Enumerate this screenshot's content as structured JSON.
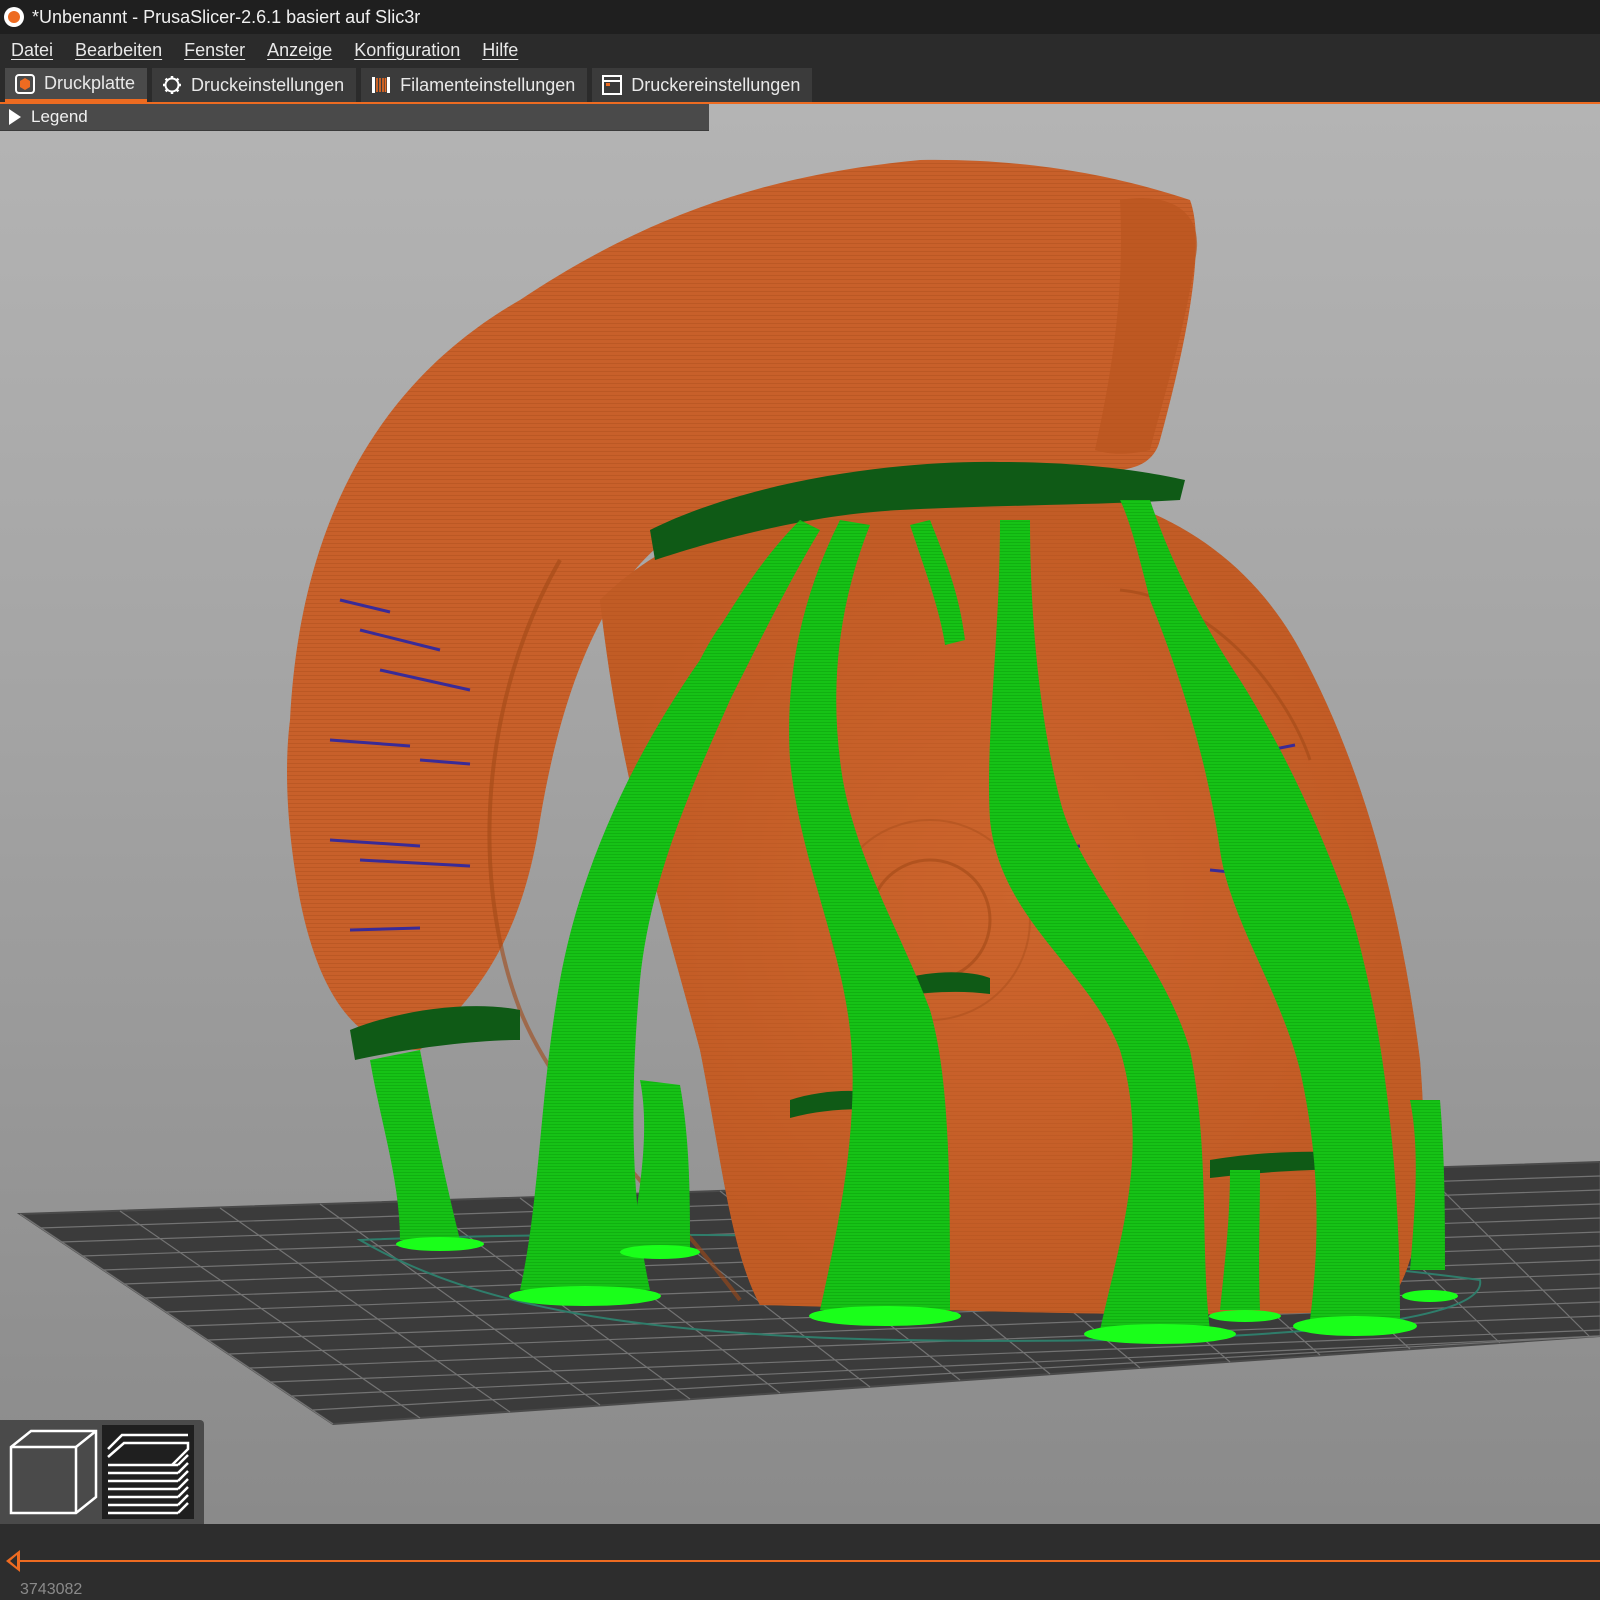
{
  "window": {
    "title": "*Unbenannt - PrusaSlicer-2.6.1 basiert auf Slic3r"
  },
  "menu": {
    "items": [
      "Datei",
      "Bearbeiten",
      "Fenster",
      "Anzeige",
      "Konfiguration",
      "Hilfe"
    ]
  },
  "tabs": [
    {
      "label": "Druckplatte",
      "icon": "plater-icon",
      "active": true
    },
    {
      "label": "Druckeinstellungen",
      "icon": "gear-icon",
      "active": false
    },
    {
      "label": "Filamenteinstellungen",
      "icon": "spool-icon",
      "active": false
    },
    {
      "label": "Druckereinstellungen",
      "icon": "printer-icon",
      "active": false
    }
  ],
  "viewport": {
    "legend_label": "Legend",
    "view_buttons": [
      {
        "name": "3d-view-button",
        "icon": "cube-icon",
        "active": false
      },
      {
        "name": "preview-button",
        "icon": "layers-icon",
        "active": true
      }
    ]
  },
  "bottom": {
    "layer_value": "3743082"
  },
  "colors": {
    "accent": "#ed6b21",
    "model": "#c8602a",
    "support": "#16c216",
    "support_interface": "#0f5a16",
    "bridge": "#2222aa",
    "bed": "#3a3a3a"
  }
}
